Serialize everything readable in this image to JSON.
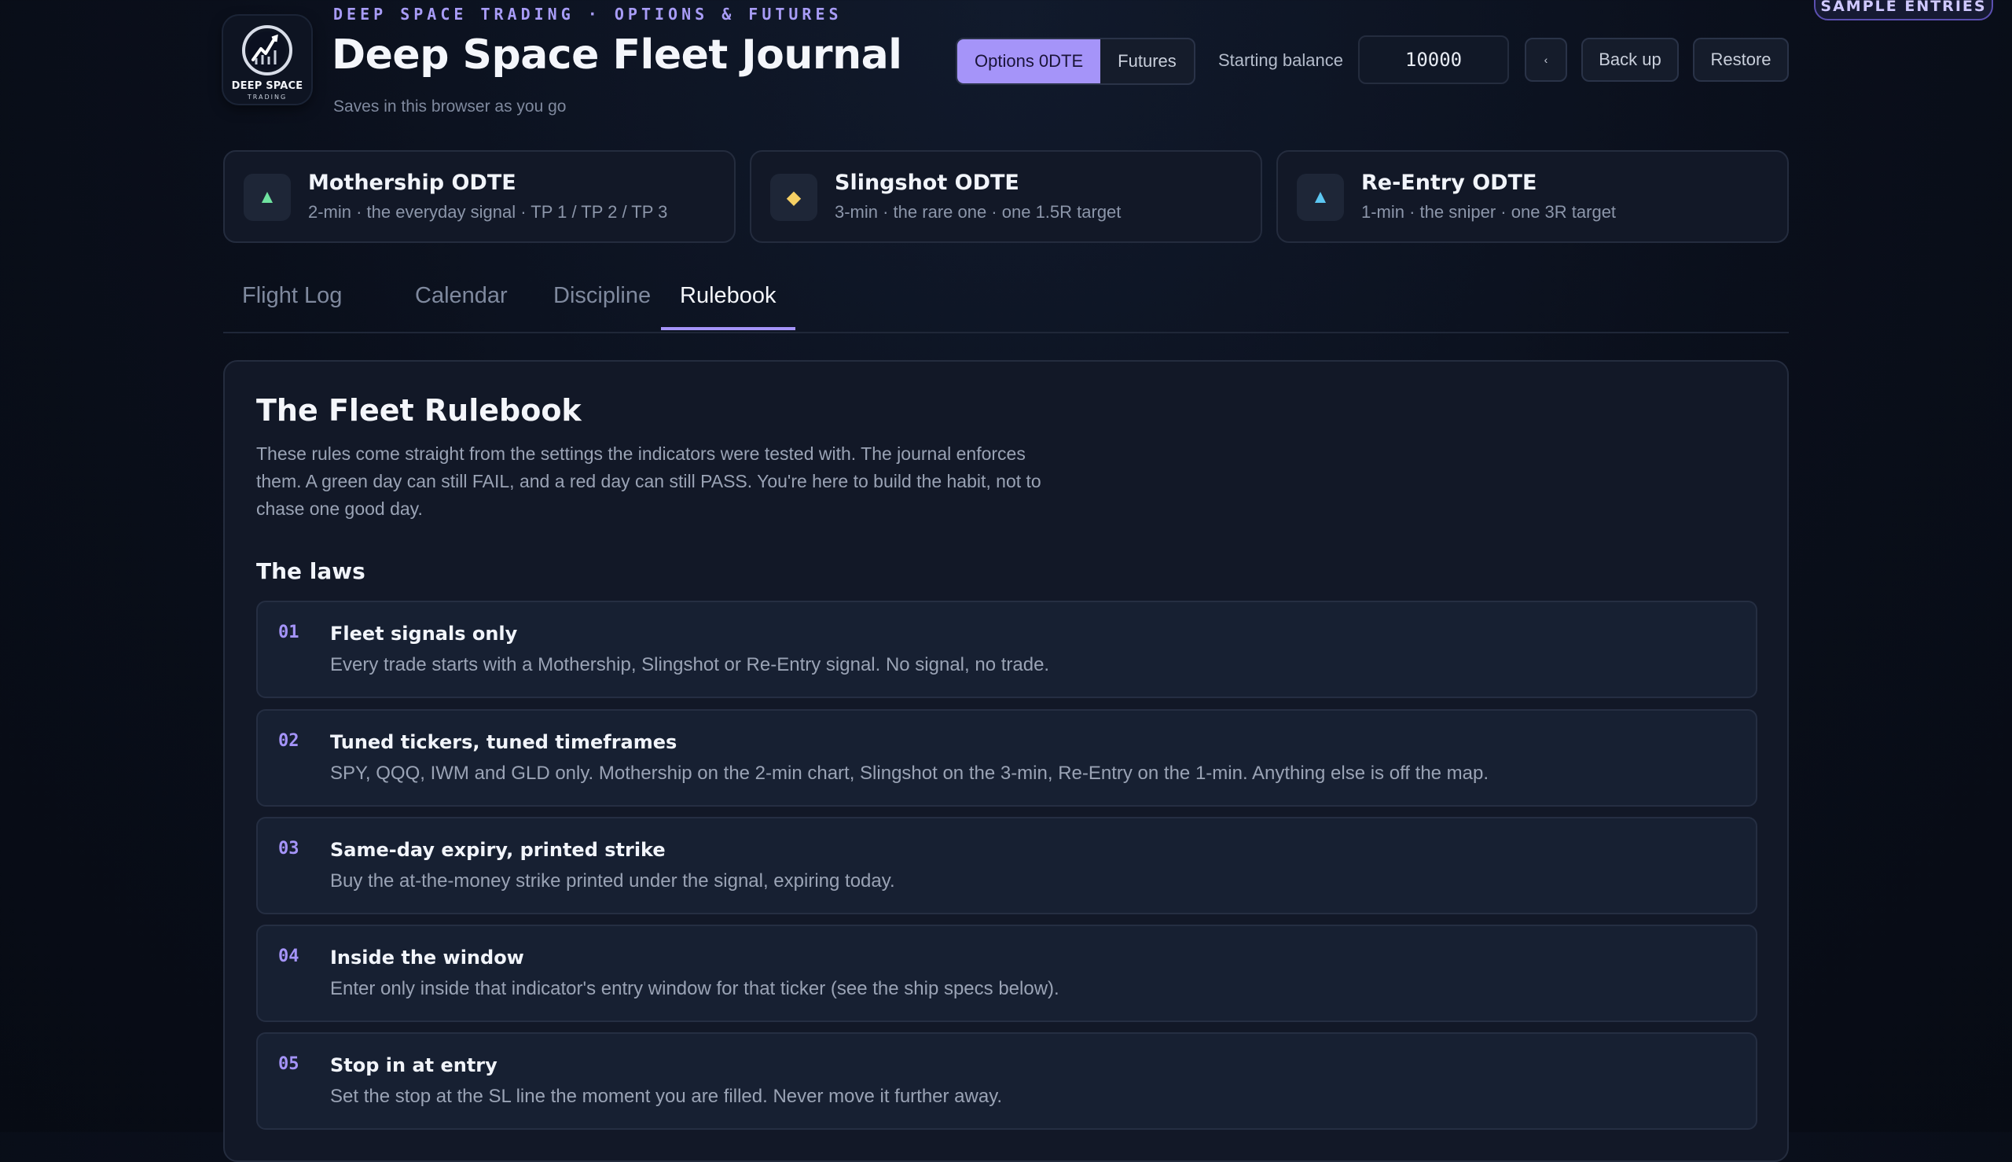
{
  "header": {
    "eyebrow": "DEEP SPACE TRADING · OPTIONS & FUTURES",
    "title": "Deep Space Fleet Journal",
    "subtitle": "Saves in this browser as you go",
    "logo_title": "DEEP SPACE",
    "logo_sub": "TRADING",
    "mode_tabs": [
      "Options 0DTE",
      "Futures"
    ],
    "active_mode": "Options 0DTE",
    "starting_balance_label": "Starting balance",
    "starting_balance_value": "10000",
    "collapse_glyph": "‹",
    "backup_label": "Back up",
    "restore_label": "Restore",
    "sample_badge": "SAMPLE ENTRIES"
  },
  "signals": [
    {
      "icon": "triangle-up-icon",
      "glyph": "▲",
      "color": "#6fe3a0",
      "name": "Mothership ODTE",
      "desc": "2-min · the everyday signal · TP 1 / TP 2 / TP 3"
    },
    {
      "icon": "diamond-icon",
      "glyph": "◆",
      "color": "#f5cf64",
      "name": "Slingshot ODTE",
      "desc": "3-min · the rare one · one 1.5R target"
    },
    {
      "icon": "triangle-up-icon",
      "glyph": "▲",
      "color": "#5cc7f2",
      "name": "Re-Entry ODTE",
      "desc": "1-min · the sniper · one 3R target"
    }
  ],
  "tabs": [
    "Flight Log",
    "Calendar",
    "Discipline",
    "Rulebook"
  ],
  "active_tab": "Rulebook",
  "rulebook": {
    "title": "The Fleet Rulebook",
    "description": "These rules come straight from the settings the indicators were tested with. The journal enforces them. A green day can still FAIL, and a red day can still PASS. You're here to build the habit, not to chase one good day.",
    "laws_heading": "The laws",
    "laws": [
      {
        "num": "01",
        "title": "Fleet signals only",
        "desc": "Every trade starts with a Mothership, Slingshot or Re-Entry signal. No signal, no trade."
      },
      {
        "num": "02",
        "title": "Tuned tickers, tuned timeframes",
        "desc": "SPY, QQQ, IWM and GLD only. Mothership on the 2-min chart, Slingshot on the 3-min, Re-Entry on the 1-min. Anything else is off the map."
      },
      {
        "num": "03",
        "title": "Same-day expiry, printed strike",
        "desc": "Buy the at-the-money strike printed under the signal, expiring today."
      },
      {
        "num": "04",
        "title": "Inside the window",
        "desc": "Enter only inside that indicator's entry window for that ticker (see the ship specs below)."
      },
      {
        "num": "05",
        "title": "Stop in at entry",
        "desc": "Set the stop at the SL line the moment you are filled. Never move it further away."
      }
    ]
  },
  "colors": {
    "accent": "#a594f9",
    "background": "#0a0f1b",
    "card": "#121827"
  }
}
